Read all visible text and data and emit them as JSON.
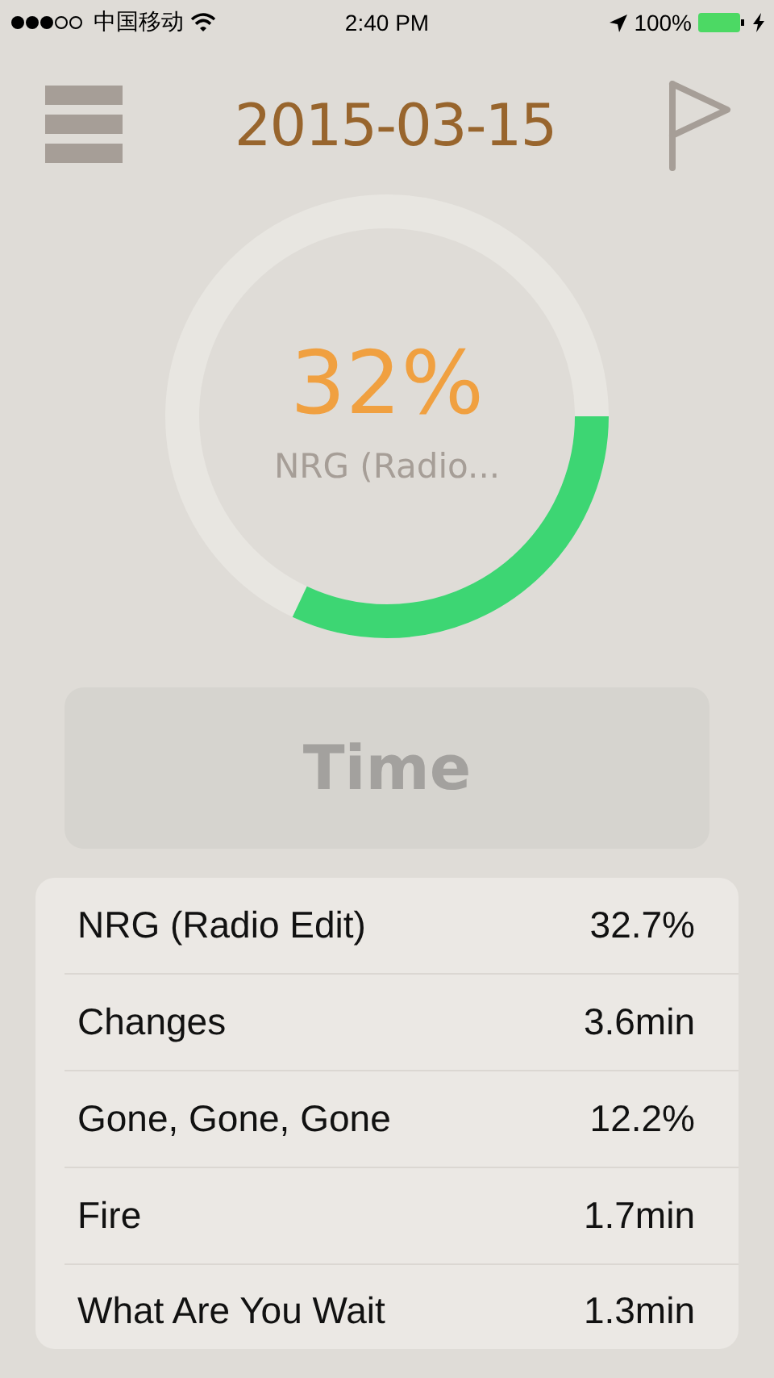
{
  "status_bar": {
    "carrier": "中国移动",
    "time": "2:40 PM",
    "battery_text": "100%"
  },
  "header": {
    "date": "2015-03-15"
  },
  "ring": {
    "level": 0.32,
    "percent": "32%",
    "track": "NRG (Radio..."
  },
  "time_button": {
    "label": "Time"
  },
  "songs": [
    {
      "title": "NRG (Radio Edit)",
      "value": "32.7%"
    },
    {
      "title": "Changes",
      "value": "3.6min"
    },
    {
      "title": "Gone, Gone, Gone",
      "value": "12.2%"
    },
    {
      "title": "Fire",
      "value": "1.7min"
    },
    {
      "title": "What Are You Wait",
      "value": "1.3min"
    }
  ]
}
